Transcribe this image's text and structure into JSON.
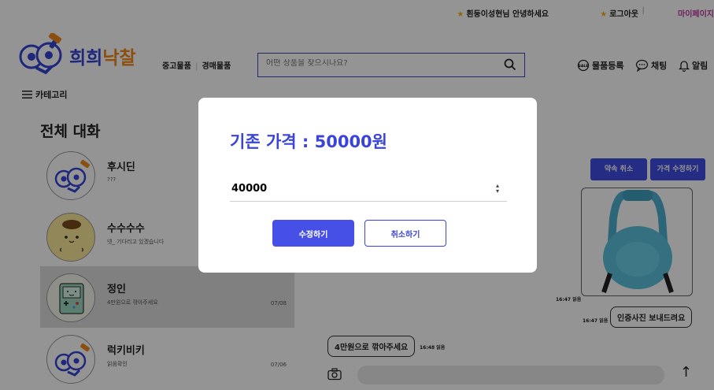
{
  "topbar": {
    "greeting": "흰둥이성현님 안녕하세요",
    "logout": "로그아웃",
    "mypage": "마이페이지"
  },
  "header": {
    "brand_a": "희희",
    "brand_b": "낙찰",
    "nav_used": "중고물품",
    "nav_auction": "경매물품",
    "search_placeholder": "어떤 상품을 찾으시나요?",
    "register": "물품등록",
    "chat": "채팅",
    "alarm": "알림",
    "category": "카테고리"
  },
  "chat_list": {
    "title": "전체 대화",
    "items": [
      {
        "name": "후시딘",
        "message": "???",
        "date": ""
      },
      {
        "name": "수수수수",
        "message": "넷_ 기다리고 있겠습니다",
        "date": ""
      },
      {
        "name": "정인",
        "message": "4만원으로 깎아주세요",
        "date": "07/08"
      },
      {
        "name": "럭키비키",
        "message": "읽음확인",
        "date": "07/06"
      }
    ]
  },
  "chat_room": {
    "cancel_promise": "약속 취소",
    "edit_price": "가격 수정하기",
    "image_time": "16:47 읽음",
    "msg_right": "인증사진 보내드려요",
    "msg_right_time": "16:47 읽음",
    "msg_left": "4만원으로 깎아주세요",
    "msg_left_time": "16:48 읽음"
  },
  "modal": {
    "title": "기존 가격 : 50000원",
    "input_value": "40000",
    "confirm": "수정하기",
    "cancel": "취소하기"
  },
  "colors": {
    "primary": "#3a44d8",
    "brand_orange": "#f08a1c",
    "star": "#f3b21b",
    "mypage": "#c23aa4"
  }
}
